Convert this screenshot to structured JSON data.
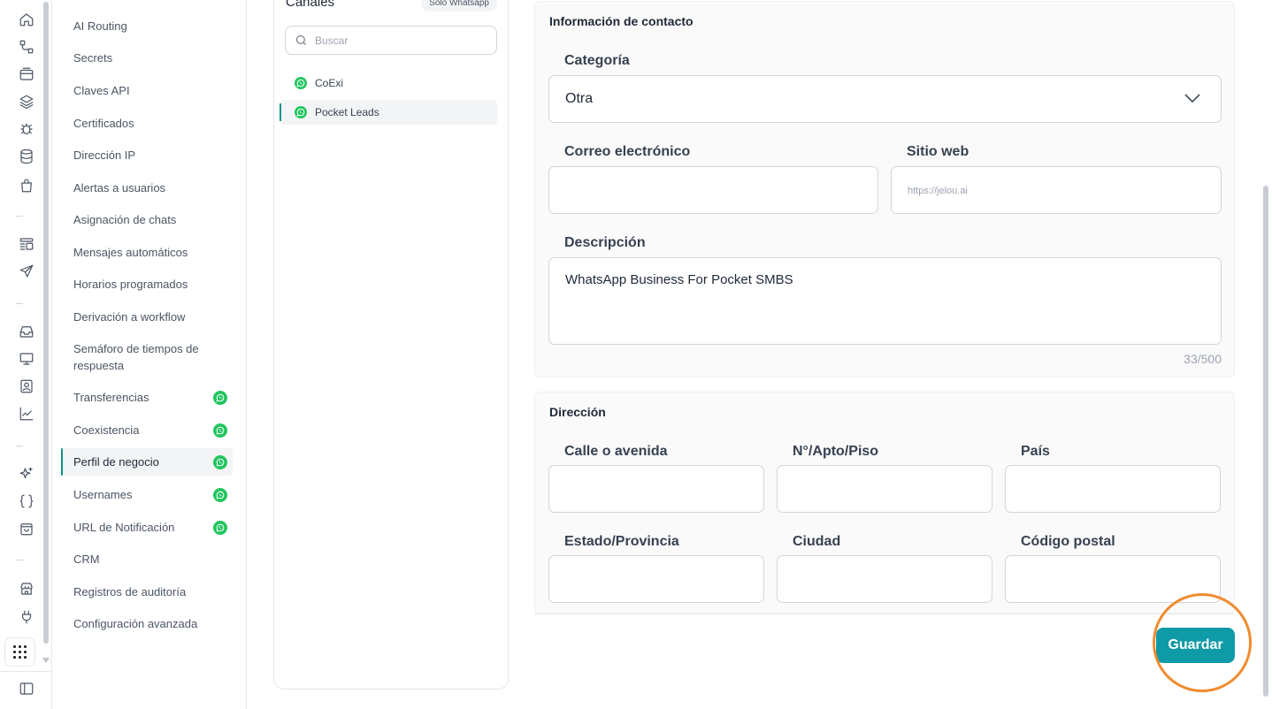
{
  "rail": {
    "icons": [
      "home-icon",
      "workflow-icon",
      "inbox-tray-icon",
      "layers-icon",
      "bug-icon",
      "database-icon",
      "shopping-bag-icon",
      "layout-list-icon",
      "send-icon",
      "inbox-icon",
      "monitor-icon",
      "contact-card-icon",
      "chart-line-icon",
      "sparkles-icon",
      "code-braces-icon",
      "bag-icon",
      "store-icon",
      "plug-icon",
      "apps-grid-icon",
      "sidebar-toggle-icon"
    ]
  },
  "nav": {
    "items": [
      {
        "label": "AI Routing",
        "wa": false
      },
      {
        "label": "Secrets",
        "wa": false
      },
      {
        "label": "Claves API",
        "wa": false
      },
      {
        "label": "Certificados",
        "wa": false
      },
      {
        "label": "Dirección IP",
        "wa": false
      },
      {
        "label": "Alertas a usuarios",
        "wa": false
      },
      {
        "label": "Asignación de chats",
        "wa": false
      },
      {
        "label": "Mensajes automáticos",
        "wa": false
      },
      {
        "label": "Horarios programados",
        "wa": false
      },
      {
        "label": "Derivación a workflow",
        "wa": false
      },
      {
        "label": "Semáforo de tiempos de respuesta",
        "wa": false
      },
      {
        "label": "Transferencias",
        "wa": true
      },
      {
        "label": "Coexistencia",
        "wa": true
      },
      {
        "label": "Perfil de negocio",
        "wa": true,
        "active": true
      },
      {
        "label": "Usernames",
        "wa": true
      },
      {
        "label": "URL de Notificación",
        "wa": true
      },
      {
        "label": "CRM",
        "wa": false
      },
      {
        "label": "Registros de auditoría",
        "wa": false
      },
      {
        "label": "Configuración avanzada",
        "wa": false
      }
    ]
  },
  "channels": {
    "title": "Canales",
    "pill": "Solo Whatsapp",
    "search_placeholder": "Buscar",
    "items": [
      {
        "label": "CoExi",
        "active": false
      },
      {
        "label": "Pocket Leads",
        "active": true
      }
    ]
  },
  "contact": {
    "title": "Información de contacto",
    "category_label": "Categoría",
    "category_value": "Otra",
    "email_label": "Correo electrónico",
    "email_value": "",
    "website_label": "Sitio web",
    "website_placeholder": "https://jelou.ai",
    "description_label": "Descripción",
    "description_value": "WhatsApp Business For Pocket SMBS",
    "char_count": "33/500"
  },
  "address": {
    "title": "Dirección",
    "street_label": "Calle o avenida",
    "number_label": "N°/Apto/Piso",
    "country_label": "País",
    "state_label": "Estado/Provincia",
    "city_label": "Ciudad",
    "zip_label": "Código postal"
  },
  "actions": {
    "save_label": "Guardar"
  },
  "colors": {
    "accent": "#0f9aa8",
    "whatsapp": "#22c55e",
    "highlight": "#f08c30"
  }
}
